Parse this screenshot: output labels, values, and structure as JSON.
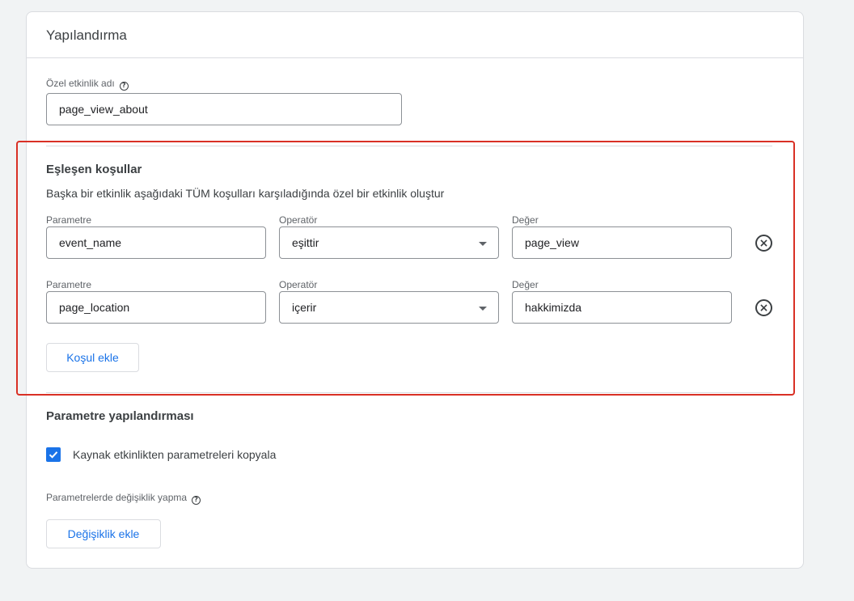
{
  "config": {
    "title": "Yapılandırma",
    "event_name_label": "Özel etkinlik adı",
    "event_name_value": "page_view_about"
  },
  "matching": {
    "title": "Eşleşen koşullar",
    "description": "Başka bir etkinlik aşağıdaki TÜM koşulları karşıladığında özel bir etkinlik oluştur",
    "conditions": [
      {
        "param_label": "Parametre",
        "param_value": "event_name",
        "operator_label": "Operatör",
        "operator_value": "eşittir",
        "value_label": "Değer",
        "value_value": "page_view"
      },
      {
        "param_label": "Parametre",
        "param_value": "page_location",
        "operator_label": "Operatör",
        "operator_value": "içerir",
        "value_label": "Değer",
        "value_value": "hakkimizda"
      }
    ],
    "add_condition_label": "Koşul ekle"
  },
  "param_config": {
    "title": "Parametre yapılandırması",
    "copy_params_label": "Kaynak etkinlikten parametreleri kopyala",
    "copy_params_checked": true,
    "modify_label": "Parametrelerde değişiklik yapma",
    "add_modification_label": "Değişiklik ekle"
  },
  "colors": {
    "accent": "#1a73e8",
    "highlight": "#d93025"
  }
}
